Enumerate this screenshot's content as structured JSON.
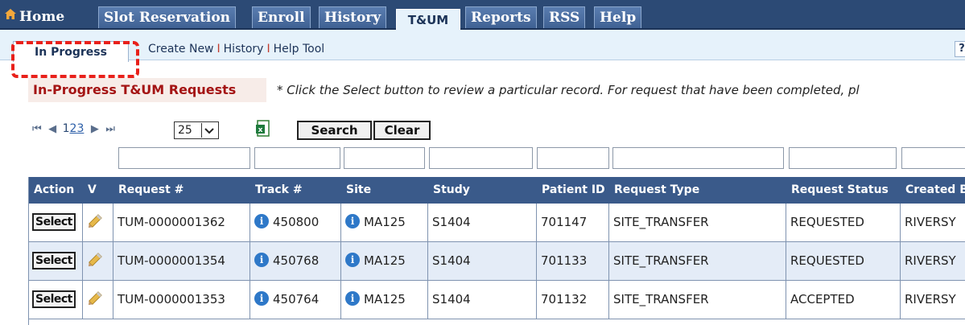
{
  "nav": {
    "home": "Home",
    "tabs": [
      {
        "label": "Slot Reservation"
      },
      {
        "label": "Enroll"
      },
      {
        "label": "History"
      },
      {
        "label": "T&UM",
        "active": true
      },
      {
        "label": "Reports"
      },
      {
        "label": "RSS"
      },
      {
        "label": "Help"
      }
    ]
  },
  "subnav": {
    "active": "In Progress",
    "links": [
      "Create New",
      "History",
      "Help Tool"
    ],
    "separator": "I",
    "help": "?"
  },
  "section": {
    "title": "In-Progress T&UM Requests",
    "instruction": "* Click the Select button to review a particular record. For request that have been completed, pl"
  },
  "toolbar": {
    "pages": [
      "1",
      "2",
      "3"
    ],
    "current_page": "1",
    "page_size": "25",
    "search_label": "Search",
    "clear_label": "Clear"
  },
  "table": {
    "headers": [
      "Action",
      "V",
      "Request #",
      "Track #",
      "Site",
      "Study",
      "Patient ID",
      "Request Type",
      "Request Status",
      "Created By"
    ],
    "action_label": "Select",
    "rows": [
      {
        "request": "TUM-0000001362",
        "track": "450800",
        "site": "MA125",
        "study": "S1404",
        "patient": "701147",
        "type": "SITE_TRANSFER",
        "status": "REQUESTED",
        "created_by": "RIVERSY"
      },
      {
        "request": "TUM-0000001354",
        "track": "450768",
        "site": "MA125",
        "study": "S1404",
        "patient": "701133",
        "type": "SITE_TRANSFER",
        "status": "REQUESTED",
        "created_by": "RIVERSY"
      },
      {
        "request": "TUM-0000001353",
        "track": "450764",
        "site": "MA125",
        "study": "S1404",
        "patient": "701132",
        "type": "SITE_TRANSFER",
        "status": "ACCEPTED",
        "created_by": "RIVERSY"
      }
    ]
  },
  "icons": {
    "home": "home-icon",
    "excel": "excel-export-icon",
    "edit": "pencil-edit-icon",
    "info": "info-icon"
  },
  "colors": {
    "nav_bg": "#2c4a75",
    "header_bg": "#3a5a8a",
    "section_title": "#a41414",
    "highlight": "#e8201a",
    "row_alt": "#e4ecf7"
  }
}
